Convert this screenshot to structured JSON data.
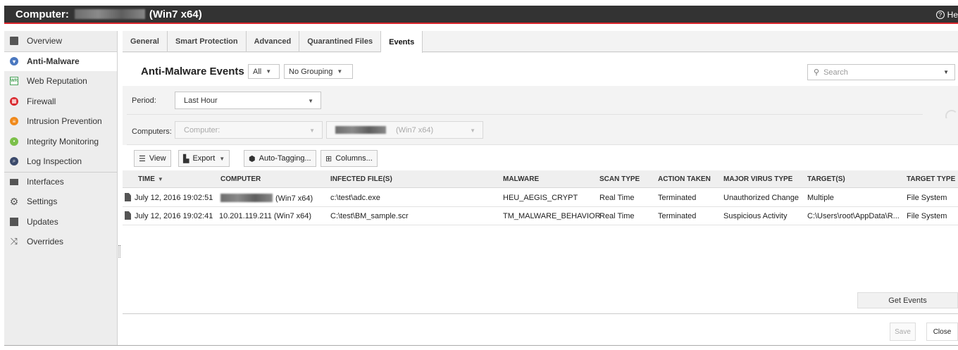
{
  "window": {
    "title_prefix": "Computer:",
    "title_suffix": "(Win7 x64)",
    "help_label": "He"
  },
  "sidebar": {
    "items": [
      {
        "label": "Overview",
        "icon": "overview-icon"
      },
      {
        "label": "Anti-Malware",
        "icon": "shield-icon",
        "active": true
      },
      {
        "label": "Web Reputation",
        "icon": "web-reputation-icon",
        "icon_text": "WR"
      },
      {
        "label": "Firewall",
        "icon": "firewall-icon"
      },
      {
        "label": "Intrusion Prevention",
        "icon": "intrusion-prevention-icon"
      },
      {
        "label": "Integrity Monitoring",
        "icon": "integrity-monitoring-icon"
      },
      {
        "label": "Log Inspection",
        "icon": "log-inspection-icon"
      },
      {
        "label": "Interfaces",
        "icon": "interfaces-icon"
      },
      {
        "label": "Settings",
        "icon": "gear-icon"
      },
      {
        "label": "Updates",
        "icon": "updates-icon"
      },
      {
        "label": "Overrides",
        "icon": "overrides-icon"
      }
    ]
  },
  "tabs": [
    {
      "label": "General"
    },
    {
      "label": "Smart Protection"
    },
    {
      "label": "Advanced"
    },
    {
      "label": "Quarantined Files"
    },
    {
      "label": "Events",
      "active": true
    }
  ],
  "header": {
    "title": "Anti-Malware Events",
    "filter_value": "All",
    "grouping_value": "No Grouping",
    "search_placeholder": "Search"
  },
  "filters": {
    "period_label": "Period:",
    "period_value": "Last Hour",
    "computers_label": "Computers:",
    "computers_value": "Computer:",
    "computer_value_suffix": "(Win7 x64)"
  },
  "toolbar": {
    "view_label": "View",
    "export_label": "Export",
    "auto_tagging_label": "Auto-Tagging...",
    "columns_label": "Columns..."
  },
  "table": {
    "columns": [
      "TIME",
      "COMPUTER",
      "INFECTED FILE(S)",
      "MALWARE",
      "SCAN TYPE",
      "ACTION TAKEN",
      "MAJOR VIRUS TYPE",
      "TARGET(S)",
      "TARGET TYPE"
    ],
    "rows": [
      {
        "time": "July 12, 2016 19:02:51",
        "computer": "(Win7 x64)",
        "infected_file": "c:\\test\\adc.exe",
        "malware": "HEU_AEGIS_CRYPT",
        "scan_type": "Real Time",
        "action_taken": "Terminated",
        "major_virus_type": "Unauthorized Change",
        "targets": "Multiple",
        "target_type": "File System"
      },
      {
        "time": "July 12, 2016 19:02:41",
        "computer": "10.201.119.211 (Win7 x64)",
        "infected_file": "C:\\test\\BM_sample.scr",
        "malware": "TM_MALWARE_BEHAVIOR",
        "scan_type": "Real Time",
        "action_taken": "Terminated",
        "major_virus_type": "Suspicious Activity",
        "targets": "C:\\Users\\root\\AppData\\R...",
        "target_type": "File System"
      }
    ]
  },
  "actions": {
    "get_events_label": "Get Events",
    "save_label": "Save",
    "close_label": "Close"
  },
  "colors": {
    "title_bar": "#333333",
    "accent_red": "#d9262c"
  }
}
